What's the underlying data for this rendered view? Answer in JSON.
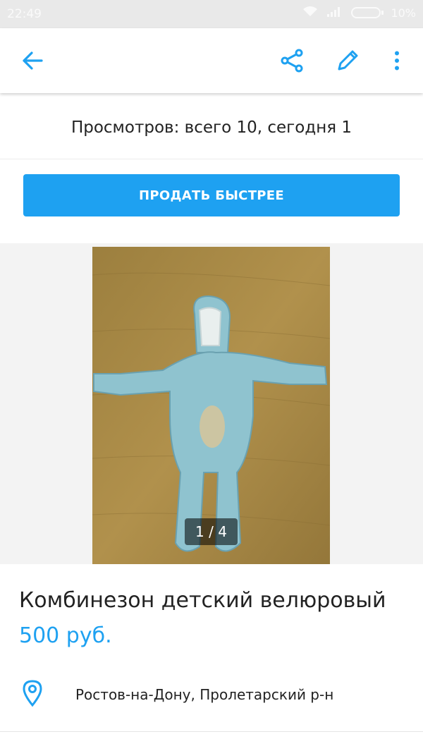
{
  "status_bar": {
    "time": "22:49",
    "battery": "10%"
  },
  "toolbar": {
    "back_icon": "arrow-left-icon",
    "share_icon": "share-icon",
    "edit_icon": "pencil-icon",
    "more_icon": "more-vertical-icon",
    "accent_color": "#1ea1f1"
  },
  "stats": {
    "views_text": "Просмотров: всего 10, сегодня 1"
  },
  "promo": {
    "sell_button_label": "ПРОДАТЬ БЫСТРЕЕ"
  },
  "gallery": {
    "counter": "1 / 4"
  },
  "listing": {
    "title": "Комбинезон детский велюровый",
    "price": "500 руб.",
    "location": "Ростов-на-Дону, Пролетарский р-н"
  }
}
